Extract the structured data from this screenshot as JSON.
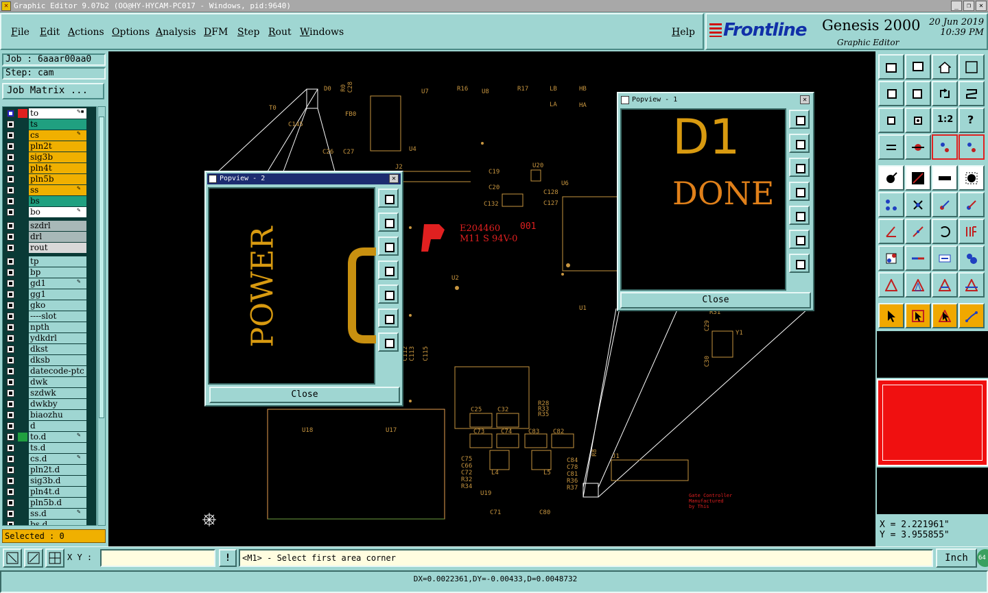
{
  "window": {
    "title": "Graphic Editor 9.07b2 (OO@HY-HYCAM-PC017 - Windows, pid:9640)",
    "controls": [
      "_",
      "❐",
      "✕"
    ]
  },
  "menu": [
    "File",
    "Edit",
    "Actions",
    "Options",
    "Analysis",
    "DFM",
    "Step",
    "Rout",
    "Windows"
  ],
  "help_label": "Help",
  "brand": {
    "logo": "Frontline",
    "product": "Genesis 2000",
    "subtitle": "Graphic Editor",
    "date": "20 Jun 2019",
    "time": "10:39 PM"
  },
  "job": {
    "job_label": "Job : 6aaar00aa0",
    "step_label": "Step: cam",
    "matrix_button": "Job Matrix ..."
  },
  "layers": [
    {
      "name": "to",
      "color": "#ffffff",
      "swatch": "#e02020",
      "selected": true,
      "mark": "✎▪"
    },
    {
      "name": "ts",
      "color": "#20a080",
      "swatch": "",
      "mark": ""
    },
    {
      "name": "cs",
      "color": "#f0b000",
      "swatch": "",
      "mark": "✎"
    },
    {
      "name": "pln2t",
      "color": "#f0b000",
      "swatch": "",
      "mark": ""
    },
    {
      "name": "sig3b",
      "color": "#f0b000",
      "swatch": "",
      "mark": ""
    },
    {
      "name": "pln4t",
      "color": "#f0b000",
      "swatch": "",
      "mark": ""
    },
    {
      "name": "pln5b",
      "color": "#f0b000",
      "swatch": "",
      "mark": ""
    },
    {
      "name": "ss",
      "color": "#f0b000",
      "swatch": "",
      "mark": "✎"
    },
    {
      "name": "bs",
      "color": "#20a080",
      "swatch": "",
      "mark": ""
    },
    {
      "name": "bo",
      "color": "#ffffff",
      "swatch": "",
      "mark": "✎"
    },
    {
      "name": "szdrl",
      "color": "#a8b8b8",
      "swatch": "",
      "mark": "",
      "gap": true
    },
    {
      "name": "drl",
      "color": "#a8b8b8",
      "swatch": "",
      "mark": ""
    },
    {
      "name": "rout",
      "color": "#d8d8d8",
      "swatch": "",
      "mark": ""
    },
    {
      "name": "tp",
      "color": "#9fd6d2",
      "swatch": "",
      "mark": "",
      "gap": true
    },
    {
      "name": "bp",
      "color": "#9fd6d2",
      "swatch": "",
      "mark": ""
    },
    {
      "name": "gd1",
      "color": "#9fd6d2",
      "swatch": "",
      "mark": "✎"
    },
    {
      "name": "gg1",
      "color": "#9fd6d2",
      "swatch": "",
      "mark": ""
    },
    {
      "name": "gko",
      "color": "#9fd6d2",
      "swatch": "",
      "mark": ""
    },
    {
      "name": "----slot",
      "color": "#9fd6d2",
      "swatch": "",
      "mark": ""
    },
    {
      "name": "npth",
      "color": "#9fd6d2",
      "swatch": "",
      "mark": ""
    },
    {
      "name": "ydkdrl",
      "color": "#9fd6d2",
      "swatch": "",
      "mark": ""
    },
    {
      "name": "dkst",
      "color": "#9fd6d2",
      "swatch": "",
      "mark": ""
    },
    {
      "name": "dksb",
      "color": "#9fd6d2",
      "swatch": "",
      "mark": ""
    },
    {
      "name": "datecode-ptc",
      "color": "#9fd6d2",
      "swatch": "",
      "mark": ""
    },
    {
      "name": "dwk",
      "color": "#9fd6d2",
      "swatch": "",
      "mark": ""
    },
    {
      "name": "szdwk",
      "color": "#9fd6d2",
      "swatch": "",
      "mark": ""
    },
    {
      "name": "dwkby",
      "color": "#9fd6d2",
      "swatch": "",
      "mark": ""
    },
    {
      "name": "biaozhu",
      "color": "#9fd6d2",
      "swatch": "",
      "mark": ""
    },
    {
      "name": "d",
      "color": "#9fd6d2",
      "swatch": "",
      "mark": ""
    },
    {
      "name": "to.d",
      "color": "#9fd6d2",
      "swatch": "#20a040",
      "mark": "✎"
    },
    {
      "name": "ts.d",
      "color": "#9fd6d2",
      "swatch": "",
      "mark": ""
    },
    {
      "name": "cs.d",
      "color": "#9fd6d2",
      "swatch": "",
      "mark": "✎"
    },
    {
      "name": "pln2t.d",
      "color": "#9fd6d2",
      "swatch": "",
      "mark": ""
    },
    {
      "name": "sig3b.d",
      "color": "#9fd6d2",
      "swatch": "",
      "mark": ""
    },
    {
      "name": "pln4t.d",
      "color": "#9fd6d2",
      "swatch": "",
      "mark": ""
    },
    {
      "name": "pln5b.d",
      "color": "#9fd6d2",
      "swatch": "",
      "mark": ""
    },
    {
      "name": "ss.d",
      "color": "#9fd6d2",
      "swatch": "",
      "mark": "✎"
    },
    {
      "name": "bs.d",
      "color": "#9fd6d2",
      "swatch": "",
      "mark": ""
    }
  ],
  "selected_label": "Selected : 0",
  "canvas": {
    "refdes": [
      "D0",
      "R0",
      "C28",
      "U7",
      "R16",
      "U8",
      "R17",
      "LB",
      "HB",
      "LA",
      "HA",
      "T0",
      "FB0",
      "C145",
      "U4",
      "C26",
      "C27",
      "J2",
      "C19",
      "U20",
      "C20",
      "C128",
      "C127",
      "C132",
      "U6",
      "U2",
      "U1",
      "C112",
      "C113",
      "C115",
      "C25",
      "C32",
      "R28",
      "R33",
      "R35",
      "C73",
      "C74",
      "C83",
      "C82",
      "U18",
      "U17",
      "C75",
      "C66",
      "C72",
      "R32",
      "R34",
      "L4",
      "L5",
      "U19",
      "C71",
      "C80",
      "C84",
      "C78",
      "C81",
      "R36",
      "R37",
      "R8",
      "J1",
      "C29",
      "C30",
      "Y1",
      "R31"
    ],
    "marking_lines": [
      "E204460",
      "M11 S 94V-0"
    ],
    "marking_code": "001",
    "silk_text": [
      "Gate Controller",
      "Manufactured",
      "by This"
    ]
  },
  "popview2": {
    "title": "Popview - 2",
    "text": "POWER",
    "close_label": "Close"
  },
  "popview1": {
    "title": "Popview - 1",
    "text_line1": "D1",
    "text_line2": "DONE",
    "close_label": "Close"
  },
  "right_tools": {
    "ratio_label": "1:2",
    "help_glyph": "?"
  },
  "coords": {
    "x": "X = 2.221961\"",
    "y": "Y = 3.955855\""
  },
  "bottom": {
    "xy_label": "X Y :",
    "xy_value": "",
    "bang": "!",
    "prompt": "<M1> - Select first area corner",
    "units": "Inch",
    "badge": "64"
  },
  "status": "DX=0.0022361,DY=-0.00433,D=0.0048732"
}
